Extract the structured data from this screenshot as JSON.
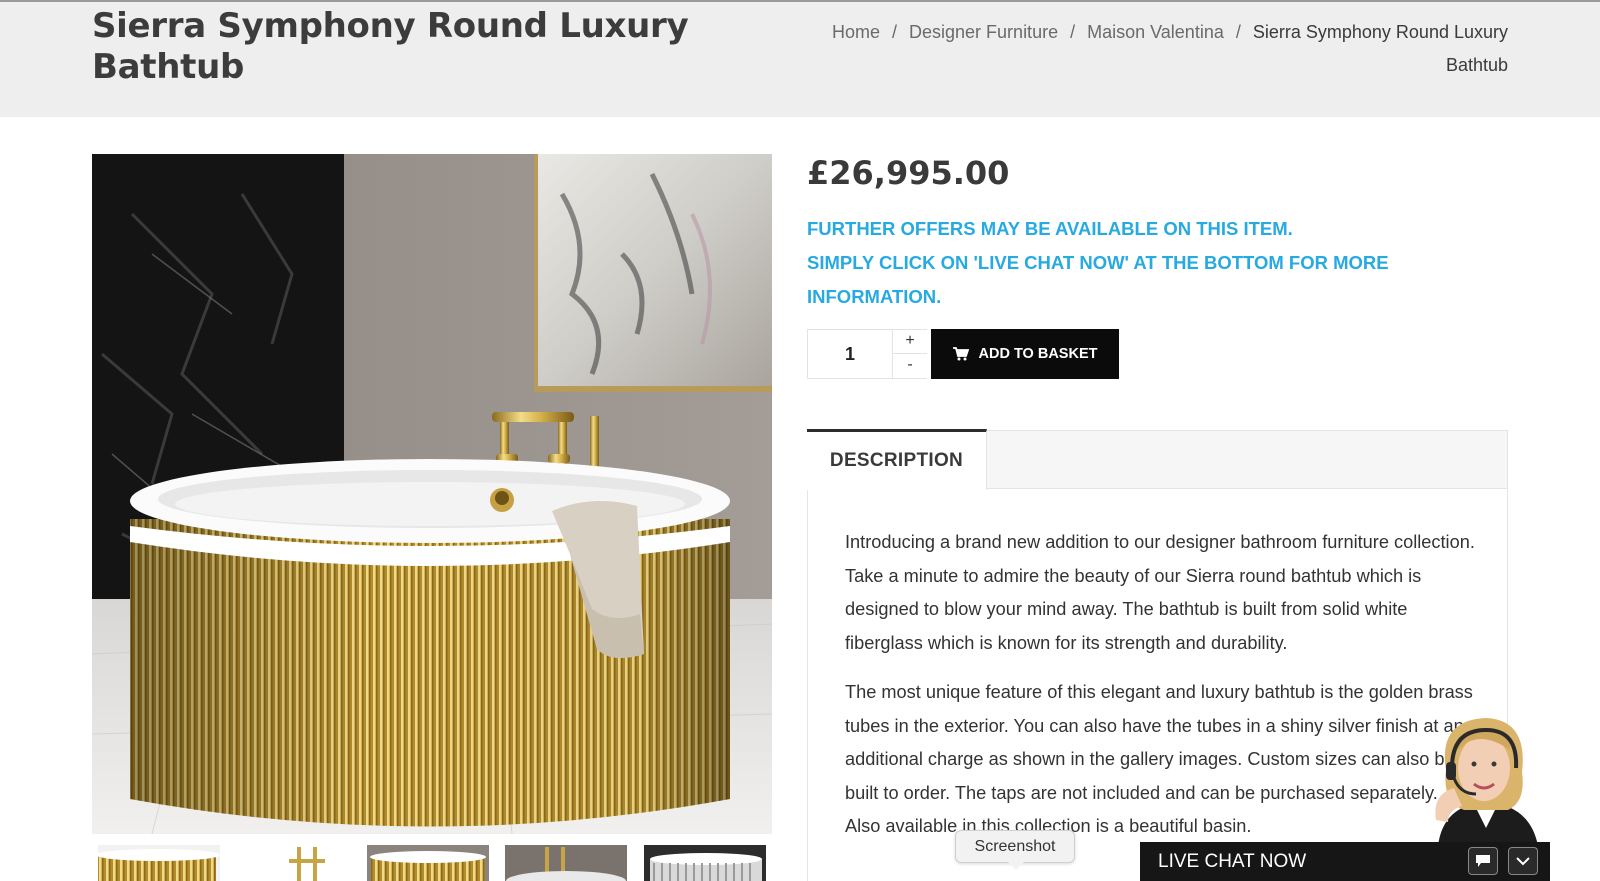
{
  "page": {
    "title": "Sierra Symphony Round Luxury Bathtub"
  },
  "breadcrumb": {
    "items": [
      "Home",
      "Designer Furniture",
      "Maison Valentina"
    ],
    "current": "Sierra Symphony Round Luxury Bathtub",
    "separator": "/"
  },
  "product": {
    "price": "£26,995.00",
    "offer_line1": "Further offers may be available on this item.",
    "offer_line2": "Simply click on 'Live Chat Now' at the bottom for more information.",
    "quantity": "1",
    "qty_plus": "+",
    "qty_minus": "-",
    "add_to_basket": "ADD TO BASKET",
    "cart_icon": "cart-icon"
  },
  "tabs": {
    "active": "DESCRIPTION"
  },
  "description": {
    "paragraphs": [
      "Introducing a brand new addition to our designer bathroom furniture collection. Take a minute to admire the beauty of our Sierra round bathtub which is designed to blow your mind away. The bathtub is built from solid white fiberglass which is known for its strength and durability.",
      "The most unique feature of this elegant and luxury bathtub is the golden brass tubes in the exterior. You can also have the tubes in a shiny silver finish at an additional charge as shown in the gallery images. Custom sizes can also be built to order. The taps are not included and can be purchased separately. Also available in this collection is a beautiful basin."
    ]
  },
  "chat": {
    "label": "LIVE CHAT NOW",
    "tooltip": "Screenshot",
    "icons": [
      "chat-bubble-icon",
      "chevron-down-icon"
    ]
  },
  "colors": {
    "accent_blue": "#27a9e1",
    "button_black": "#0b0b0b",
    "header_bg": "#eeeeee",
    "brass": "#d4b04a"
  }
}
